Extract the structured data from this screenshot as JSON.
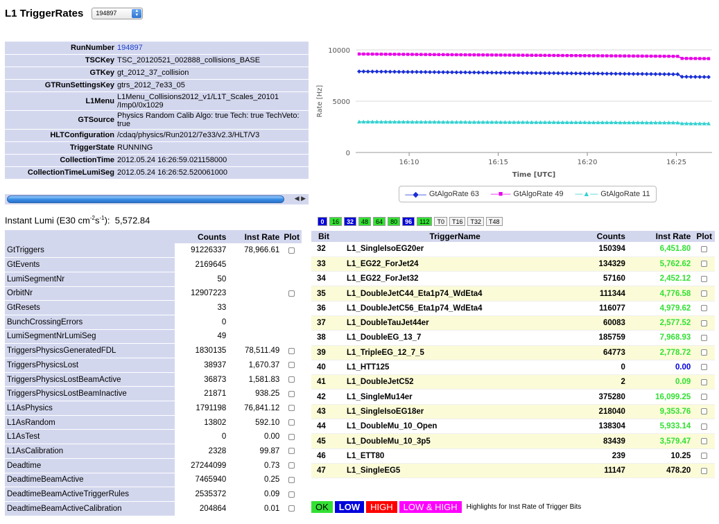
{
  "header": {
    "title": "L1 TriggerRates",
    "run_select": "194897"
  },
  "colors": {
    "rate_ok": "#33e033",
    "rate_low": "#0000dd",
    "rate_high": "#ff0000",
    "rate_lowhigh": "#ff00ff",
    "header_bg": "#d3d7ee",
    "odd_row": "#fbfbd8"
  },
  "info": [
    {
      "key": "RunNumber",
      "value": "194897"
    },
    {
      "key": "TSCKey",
      "value": "TSC_20120521_002888_collisions_BASE"
    },
    {
      "key": "GTKey",
      "value": "gt_2012_37_collision"
    },
    {
      "key": "GTRunSettingsKey",
      "value": "gtrs_2012_7e33_05"
    },
    {
      "key": "L1Menu",
      "value": "L1Menu_Collisions2012_v1/L1T_Scales_20101 /Imp0/0x1029"
    },
    {
      "key": "GTSource",
      "value": "Physics Random Calib Algo: true Tech: true TechVeto: true"
    },
    {
      "key": "HLTConfiguration",
      "value": "/cdaq/physics/Run2012/7e33/v2.3/HLT/V3"
    },
    {
      "key": "TriggerState",
      "value": "RUNNING"
    },
    {
      "key": "CollectionTime",
      "value": "2012.05.24 16:26:59.021158000"
    },
    {
      "key": "CollectionTimeLumiSeg",
      "value": "2012.05.24 16:26:52.520061000"
    }
  ],
  "lumi": {
    "label_pre": "Instant Lumi (E30 cm",
    "exp1": "-2",
    "mid": "s",
    "exp2": "-1",
    "label_post": "):",
    "value": "5,572.84"
  },
  "counters": {
    "headers": [
      "",
      "Counts",
      "Inst Rate",
      "Plot"
    ],
    "rows": [
      {
        "name": "GtTriggers",
        "counts": "91226337",
        "rate": "78,966.61",
        "plot": true
      },
      {
        "name": "GtEvents",
        "counts": "2169645",
        "rate": "",
        "plot": false
      },
      {
        "name": "LumiSegmentNr",
        "counts": "50",
        "rate": "",
        "plot": false
      },
      {
        "name": "OrbitNr",
        "counts": "12907223",
        "rate": "",
        "plot": true
      },
      {
        "name": "GtResets",
        "counts": "33",
        "rate": "",
        "plot": false
      },
      {
        "name": "BunchCrossingErrors",
        "counts": "0",
        "rate": "",
        "plot": false
      },
      {
        "name": "LumiSegmentNrLumiSeg",
        "counts": "49",
        "rate": "",
        "plot": false
      },
      {
        "name": "TriggersPhysicsGeneratedFDL",
        "counts": "1830135",
        "rate": "78,511.49",
        "plot": true
      },
      {
        "name": "TriggersPhysicsLost",
        "counts": "38937",
        "rate": "1,670.37",
        "plot": true
      },
      {
        "name": "TriggersPhysicsLostBeamActive",
        "counts": "36873",
        "rate": "1,581.83",
        "plot": true
      },
      {
        "name": "TriggersPhysicsLostBeamInactive",
        "counts": "21871",
        "rate": "938.25",
        "plot": true
      },
      {
        "name": "L1AsPhysics",
        "counts": "1791198",
        "rate": "76,841.12",
        "plot": true
      },
      {
        "name": "L1AsRandom",
        "counts": "13802",
        "rate": "592.10",
        "plot": true
      },
      {
        "name": "L1AsTest",
        "counts": "0",
        "rate": "0.00",
        "plot": true
      },
      {
        "name": "L1AsCalibration",
        "counts": "2328",
        "rate": "99.87",
        "plot": true
      },
      {
        "name": "Deadtime",
        "counts": "27244099",
        "rate": "0.73",
        "plot": true
      },
      {
        "name": "DeadtimeBeamActive",
        "counts": "7465940",
        "rate": "0.25",
        "plot": true
      },
      {
        "name": "DeadtimeBeamActiveTriggerRules",
        "counts": "2535372",
        "rate": "0.09",
        "plot": true
      },
      {
        "name": "DeadtimeBeamActiveCalibration",
        "counts": "204864",
        "rate": "0.01",
        "plot": true
      }
    ]
  },
  "bit_buttons": [
    {
      "label": "0",
      "style": "blue"
    },
    {
      "label": "16",
      "style": "green"
    },
    {
      "label": "32",
      "style": "blue"
    },
    {
      "label": "48",
      "style": "green"
    },
    {
      "label": "64",
      "style": "green"
    },
    {
      "label": "80",
      "style": "green"
    },
    {
      "label": "96",
      "style": "blue"
    },
    {
      "label": "112",
      "style": "green"
    },
    {
      "label": "T0",
      "style": "white"
    },
    {
      "label": "T16",
      "style": "white"
    },
    {
      "label": "T32",
      "style": "white"
    },
    {
      "label": "T48",
      "style": "white"
    }
  ],
  "triggers": {
    "headers": [
      "Bit",
      "TriggerName",
      "Counts",
      "Inst Rate",
      "Plot"
    ],
    "rows": [
      {
        "bit": "32",
        "name": "L1_SingleIsoEG20er",
        "counts": "150394",
        "rate": "6,451.80",
        "color": "green"
      },
      {
        "bit": "33",
        "name": "L1_EG22_ForJet24",
        "counts": "134329",
        "rate": "5,762.62",
        "color": "green"
      },
      {
        "bit": "34",
        "name": "L1_EG22_ForJet32",
        "counts": "57160",
        "rate": "2,452.12",
        "color": "green"
      },
      {
        "bit": "35",
        "name": "L1_DoubleJetC44_Eta1p74_WdEta4",
        "counts": "111344",
        "rate": "4,776.58",
        "color": "green"
      },
      {
        "bit": "36",
        "name": "L1_DoubleJetC56_Eta1p74_WdEta4",
        "counts": "116077",
        "rate": "4,979.62",
        "color": "green"
      },
      {
        "bit": "37",
        "name": "L1_DoubleTauJet44er",
        "counts": "60083",
        "rate": "2,577.52",
        "color": "green"
      },
      {
        "bit": "38",
        "name": "L1_DoubleEG_13_7",
        "counts": "185759",
        "rate": "7,968.93",
        "color": "green"
      },
      {
        "bit": "39",
        "name": "L1_TripleEG_12_7_5",
        "counts": "64773",
        "rate": "2,778.72",
        "color": "green"
      },
      {
        "bit": "40",
        "name": "L1_HTT125",
        "counts": "0",
        "rate": "0.00",
        "color": "blue"
      },
      {
        "bit": "41",
        "name": "L1_DoubleJetC52",
        "counts": "2",
        "rate": "0.09",
        "color": "green"
      },
      {
        "bit": "42",
        "name": "L1_SingleMu14er",
        "counts": "375280",
        "rate": "16,099.25",
        "color": "green"
      },
      {
        "bit": "43",
        "name": "L1_SingleIsoEG18er",
        "counts": "218040",
        "rate": "9,353.76",
        "color": "green"
      },
      {
        "bit": "44",
        "name": "L1_DoubleMu_10_Open",
        "counts": "138304",
        "rate": "5,933.14",
        "color": "green"
      },
      {
        "bit": "45",
        "name": "L1_DoubleMu_10_3p5",
        "counts": "83439",
        "rate": "3,579.47",
        "color": "green"
      },
      {
        "bit": "46",
        "name": "L1_ETT80",
        "counts": "239",
        "rate": "10.25",
        "color": "black"
      },
      {
        "bit": "47",
        "name": "L1_SingleEG5",
        "counts": "11147",
        "rate": "478.20",
        "color": "black"
      }
    ]
  },
  "highlights": {
    "ok": "OK",
    "low": "LOW",
    "high": "HIGH",
    "lowhigh": "LOW & HIGH",
    "text": "Highlights for Inst Rate of Trigger Bits"
  },
  "chart_data": {
    "type": "line",
    "xlabel": "Time [UTC]",
    "ylabel": "Rate [Hz]",
    "ylim": [
      0,
      10000
    ],
    "yticks": [
      "0",
      "5000",
      "10000"
    ],
    "xticks": [
      "16:10",
      "16:15",
      "16:20",
      "16:25"
    ],
    "xrange": [
      "16:07",
      "16:27"
    ],
    "series": [
      {
        "name": "GtAlgoRate 63",
        "color": "#1a2fd6",
        "marker": "diamond",
        "start": 7900,
        "end": 7600
      },
      {
        "name": "GtAlgoRate 49",
        "color": "#e800e8",
        "marker": "square",
        "start": 9600,
        "end": 9350
      },
      {
        "name": "GtAlgoRate 11",
        "color": "#33d1d1",
        "marker": "triangle",
        "start": 3000,
        "end": 2900
      }
    ],
    "grid": "horizontal",
    "legend": "bottom"
  }
}
